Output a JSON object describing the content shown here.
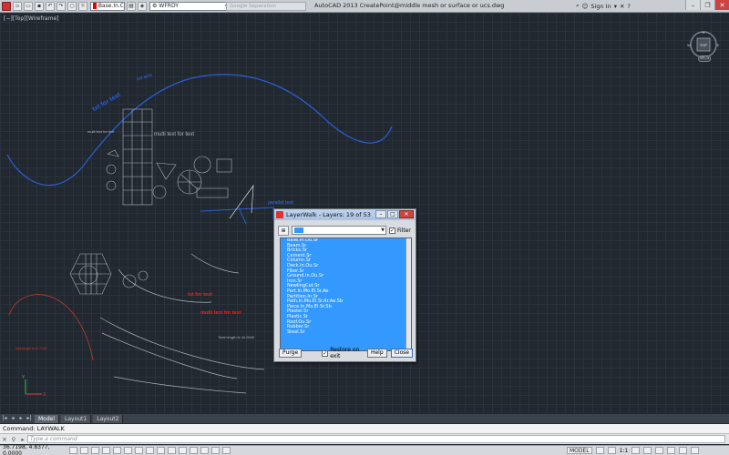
{
  "titlebar": {
    "layer_combo": "Base.In.C",
    "workspace": "WFRDY",
    "search_placeholder": "Google Separation",
    "app_title": "AutoCAD 2013    CreatePoint@middle mesh or surface or ucs.dwg",
    "sign_in": "Sign In"
  },
  "viewport": {
    "label": "[−][Top][Wireframe]"
  },
  "drawing_text": {
    "curved_blue_1": "txt for text",
    "curved_blue_2": "txt actx",
    "gray_small": "multi text for text",
    "gray_large": "multi text for text",
    "blue_small": "parallel text",
    "red_1": "txt for text",
    "red_2": "multi text for text",
    "length_label": "Total length is 44.2600",
    "red_left": "Total length is 10.7746"
  },
  "viewcube": {
    "center": "TOP",
    "wcs": "WCS",
    "n": "N",
    "s": "S",
    "e": "E",
    "w": "W"
  },
  "tabs": [
    "Model",
    "Layout1",
    "Layout2"
  ],
  "command": {
    "history": "Command:   LAYWALK",
    "placeholder": "Type a command"
  },
  "statusbar": {
    "coords": "36.7198, 4.8377, 0.0000",
    "model": "MODEL",
    "scale": "1:1"
  },
  "dialog": {
    "title": "LayerWalk - Layers: 19 of 53",
    "filter_label": "Filter",
    "restore_label": "Restore on exit",
    "purge": "Purge",
    "help": "Help",
    "close": "Close",
    "layers": [
      "Base.In.Ou.Sr",
      "Beam.Sr",
      "Bricks.Sr",
      "Cement.Sr",
      "Column.Sr",
      "Deck.In.Ou.Sr",
      "Fiber.Sr",
      "Ground.In.Ou.Sr",
      "Iron.Sr",
      "NewlingCut.Sr",
      "Part.In.Mo.El.Sr.Ae",
      "Partition.In.Sr",
      "Path.In.Mo.El.Sr.Ar.Ae.Sb",
      "Piece.In.Mo.El.Sr.Sb",
      "Plaster.Sr",
      "Plastic.Sr",
      "Roof.Ou.Sr",
      "Rubber.Sr",
      "Steel.Sr"
    ]
  }
}
